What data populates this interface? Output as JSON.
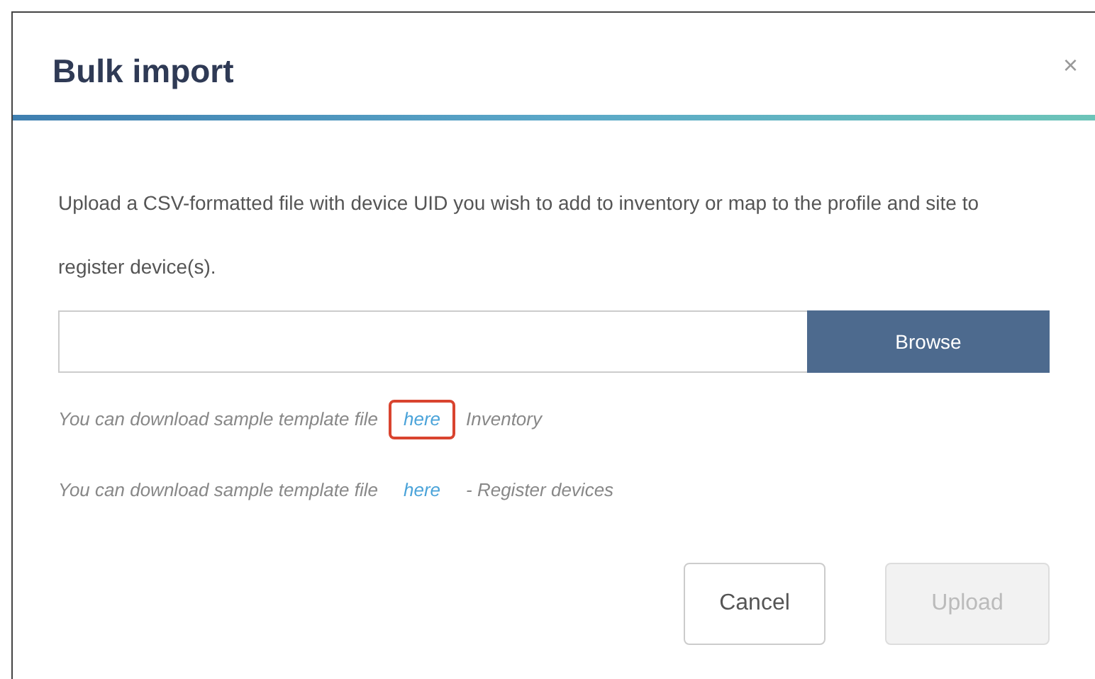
{
  "dialog": {
    "title": "Bulk import",
    "close": "×"
  },
  "description": "Upload a CSV-formatted file with device UID you wish to add to inventory or map to the profile and site to register device(s).",
  "file_field": {
    "button": "Browse"
  },
  "template_lines": [
    {
      "text": "You can download sample template file",
      "link": "here",
      "suffix": "Inventory",
      "highlighted": true
    },
    {
      "text": "You can download sample template file",
      "link": "here",
      "suffix": "- Register devices",
      "highlighted": false
    }
  ],
  "buttons": [
    {
      "label": "Cancel",
      "disabled": false
    },
    {
      "label": "Upload",
      "disabled": true
    }
  ]
}
